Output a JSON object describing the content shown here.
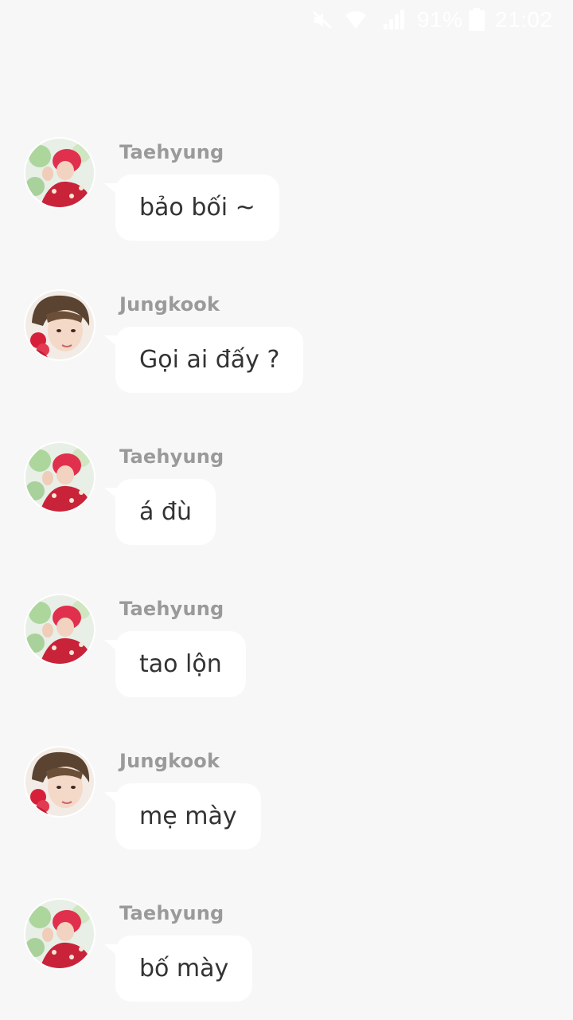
{
  "status_bar": {
    "battery_percent": "91%",
    "time": "21:02",
    "icons": [
      "mute-icon",
      "wifi-icon",
      "signal-icon",
      "battery-icon"
    ]
  },
  "colors": {
    "background": "#f7f7f7",
    "bubble": "#ffffff",
    "sender_name": "#9a9a9a",
    "message_text": "#333333"
  },
  "messages": [
    {
      "sender": "Taehyung",
      "text": "bảo bối ~"
    },
    {
      "sender": "Jungkook",
      "text": "Gọi ai đấy ?"
    },
    {
      "sender": "Taehyung",
      "text": "á đù"
    },
    {
      "sender": "Taehyung",
      "text": "tao lộn"
    },
    {
      "sender": "Jungkook",
      "text": "mẹ mày"
    },
    {
      "sender": "Taehyung",
      "text": "bố mày"
    }
  ]
}
